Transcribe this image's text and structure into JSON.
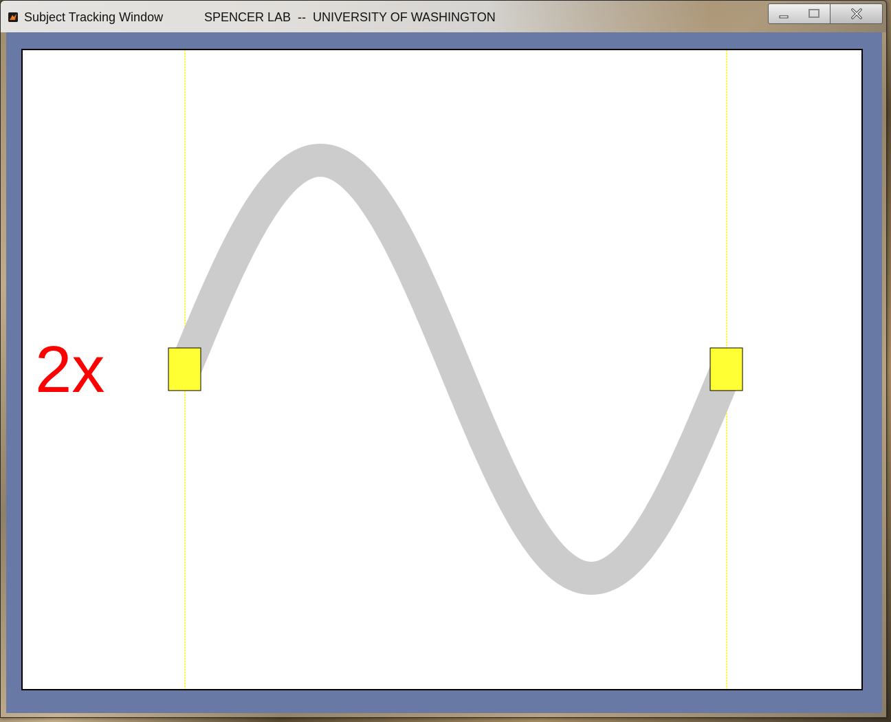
{
  "window": {
    "title": "Subject Tracking Window",
    "subtitle": "SPENCER LAB  --  UNIVERSITY OF WASHINGTON",
    "controls": {
      "minimize": "minimize-icon",
      "maximize": "maximize-icon",
      "close": "close-icon"
    }
  },
  "tracking": {
    "speed_label": "2x",
    "path_color": "#cccccc",
    "marker_color": "#ffff33",
    "guide_color": "#ffff00",
    "label_color": "#ff0000",
    "background_color": "#6779a4"
  }
}
